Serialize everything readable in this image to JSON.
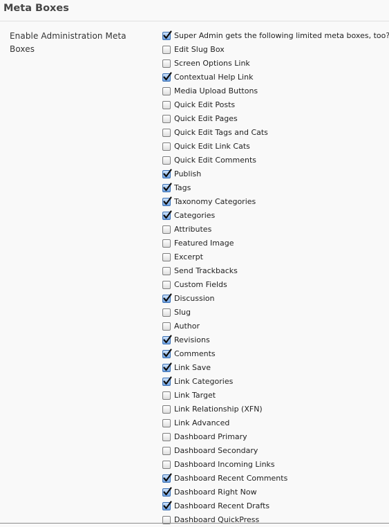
{
  "section": {
    "title": "Meta Boxes"
  },
  "setting": {
    "label": "Enable Administration Meta Boxes"
  },
  "colors": {
    "checkbox_checked": "#6fa3e3",
    "checkmark": "#0d0d0d",
    "background": "#f9f9f9"
  },
  "options": [
    {
      "label": "Super Admin gets the following limited meta boxes, too?",
      "checked": true
    },
    {
      "label": "Edit Slug Box",
      "checked": false
    },
    {
      "label": "Screen Options Link",
      "checked": false
    },
    {
      "label": "Contextual Help Link",
      "checked": true
    },
    {
      "label": "Media Upload Buttons",
      "checked": false
    },
    {
      "label": "Quick Edit Posts",
      "checked": false
    },
    {
      "label": "Quick Edit Pages",
      "checked": false
    },
    {
      "label": "Quick Edit Tags and Cats",
      "checked": false
    },
    {
      "label": "Quick Edit Link Cats",
      "checked": false
    },
    {
      "label": "Quick Edit Comments",
      "checked": false
    },
    {
      "label": "Publish",
      "checked": true
    },
    {
      "label": "Tags",
      "checked": true
    },
    {
      "label": "Taxonomy Categories",
      "checked": true
    },
    {
      "label": "Categories",
      "checked": true
    },
    {
      "label": "Attributes",
      "checked": false
    },
    {
      "label": "Featured Image",
      "checked": false
    },
    {
      "label": "Excerpt",
      "checked": false
    },
    {
      "label": "Send Trackbacks",
      "checked": false
    },
    {
      "label": "Custom Fields",
      "checked": false
    },
    {
      "label": "Discussion",
      "checked": true
    },
    {
      "label": "Slug",
      "checked": false
    },
    {
      "label": "Author",
      "checked": false
    },
    {
      "label": "Revisions",
      "checked": true
    },
    {
      "label": "Comments",
      "checked": true
    },
    {
      "label": "Link Save",
      "checked": true
    },
    {
      "label": "Link Categories",
      "checked": true
    },
    {
      "label": "Link Target",
      "checked": false
    },
    {
      "label": "Link Relationship (XFN)",
      "checked": false
    },
    {
      "label": "Link Advanced",
      "checked": false
    },
    {
      "label": "Dashboard Primary",
      "checked": false
    },
    {
      "label": "Dashboard Secondary",
      "checked": false
    },
    {
      "label": "Dashboard Incoming Links",
      "checked": false
    },
    {
      "label": "Dashboard Recent Comments",
      "checked": true
    },
    {
      "label": "Dashboard Right Now",
      "checked": true
    },
    {
      "label": "Dashboard Recent Drafts",
      "checked": true
    },
    {
      "label": "Dashboard QuickPress",
      "checked": false
    }
  ]
}
